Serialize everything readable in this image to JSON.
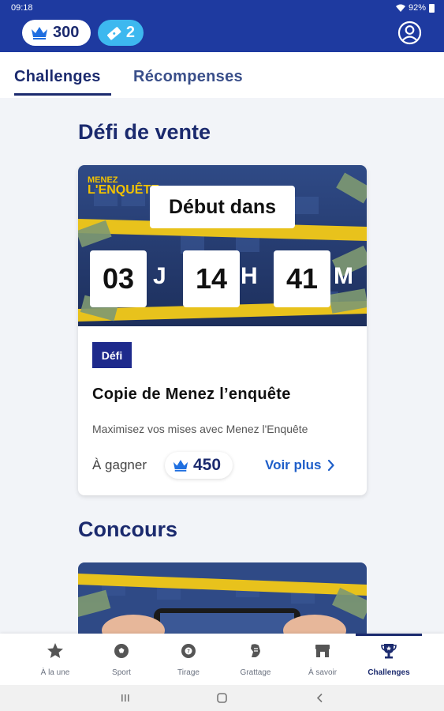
{
  "status": {
    "time": "09:18",
    "battery": "92%"
  },
  "header": {
    "crowns": "300",
    "tickets": "2"
  },
  "tabs": [
    {
      "label": "Challenges"
    },
    {
      "label": "Récompenses"
    }
  ],
  "sections": {
    "defi_title": "Défi de vente",
    "concours_title": "Concours"
  },
  "card": {
    "banner": {
      "start_label": "Début dans",
      "countdown": {
        "days": "03",
        "days_unit": "J",
        "hours": "14",
        "hours_unit": "H",
        "minutes": "41",
        "minutes_unit": "M"
      }
    },
    "badge": "Défi",
    "title": "Copie de Menez l’enquête",
    "description": "Maximisez vos mises avec Menez l'Enquête",
    "win_label": "À gagner",
    "win_amount": "450",
    "more_label": "Voir plus"
  },
  "bottom_nav": [
    {
      "label": "À la une",
      "icon": "star-icon"
    },
    {
      "label": "Sport",
      "icon": "soccer-ball-icon"
    },
    {
      "label": "Tirage",
      "icon": "lottery-ball-icon"
    },
    {
      "label": "Grattage",
      "icon": "scratch-icon"
    },
    {
      "label": "À savoir",
      "icon": "store-icon"
    },
    {
      "label": "Challenges",
      "icon": "trophy-icon",
      "active": true
    }
  ],
  "colors": {
    "brand": "#1e3aa0",
    "accent": "#3db8ef",
    "link": "#1f5fc9",
    "text_dark": "#1b2a6e"
  }
}
